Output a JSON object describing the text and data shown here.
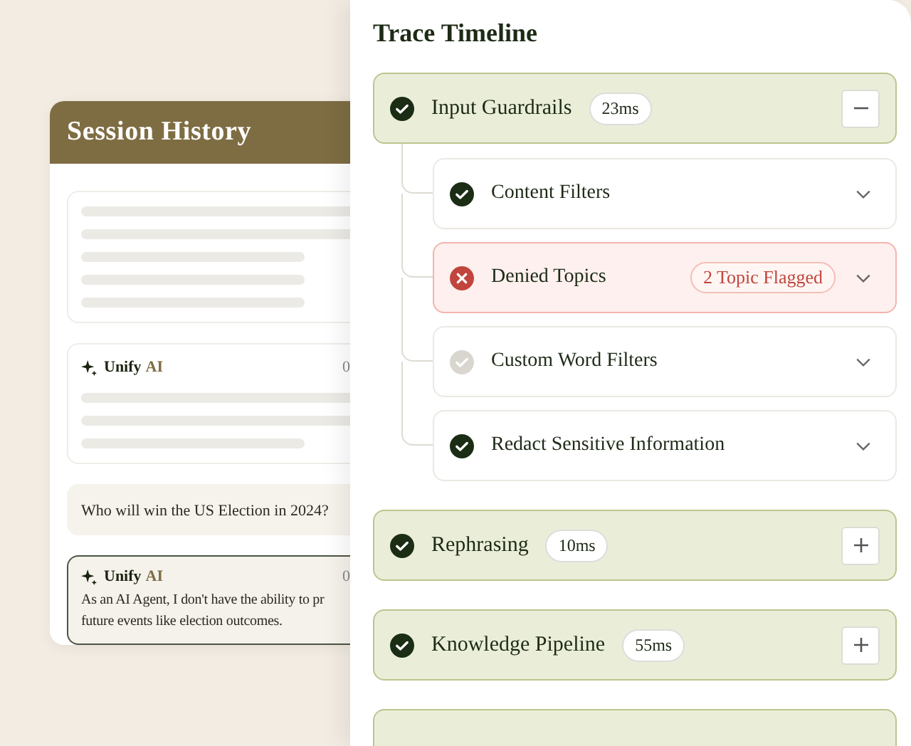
{
  "session_history": {
    "title": "Session History",
    "blocks": [
      {
        "kind": "skeleton"
      },
      {
        "kind": "agent_skeleton",
        "brand": "Unify",
        "brand_suffix": "AI",
        "time": "0"
      },
      {
        "kind": "user",
        "text": "Who will win the US Election in 2024?"
      },
      {
        "kind": "agent",
        "brand": "Unify",
        "brand_suffix": "AI",
        "time": "0",
        "lines": [
          "As an AI Agent, I don't have the ability to pr",
          "future events like election outcomes."
        ]
      }
    ]
  },
  "trace": {
    "title": "Trace Timeline",
    "steps": [
      {
        "label": "Input Guardrails",
        "duration": "23ms",
        "kind": "passed",
        "expanded": true,
        "children": [
          {
            "label": "Content Filters",
            "kind": "passed"
          },
          {
            "label": "Denied Topics",
            "kind": "failed",
            "flag": "2 Topic Flagged"
          },
          {
            "label": "Custom Word Filters",
            "kind": "skipped"
          },
          {
            "label": "Redact Sensitive Information",
            "kind": "passed"
          }
        ]
      },
      {
        "label": "Rephrasing",
        "duration": "10ms",
        "kind": "passed",
        "expanded": false
      },
      {
        "label": "Knowledge Pipeline",
        "duration": "55ms",
        "kind": "passed",
        "expanded": false
      }
    ]
  }
}
